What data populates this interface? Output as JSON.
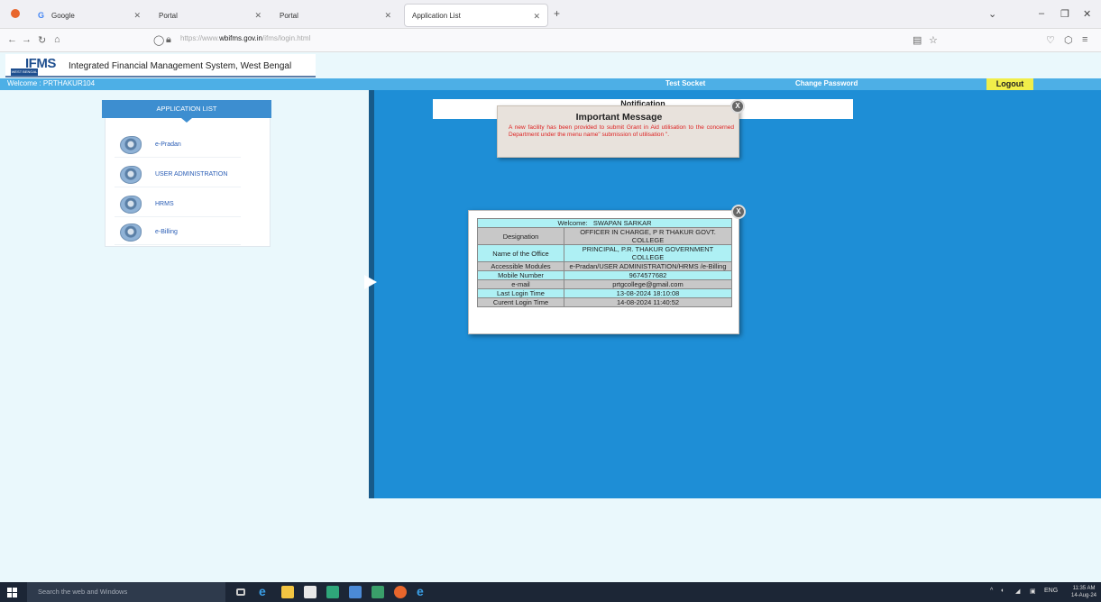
{
  "browser": {
    "tabs": [
      {
        "label": "Google",
        "active": false
      },
      {
        "label": "Portal",
        "active": false
      },
      {
        "label": "Portal",
        "active": false
      },
      {
        "label": "Application List",
        "active": true
      }
    ],
    "new_tab": "+",
    "url_prefix": "https://www.",
    "url_domain": "wbifms.gov.in",
    "url_path": "/ifms/login.html"
  },
  "header": {
    "logo_text": "IFMS",
    "logo_sub": "WEST BENGAL",
    "system_title": "Integrated Financial Management System, West Bengal"
  },
  "topbar": {
    "welcome": "Welcome : PRTHAKUR104",
    "test_socket": "Test Socket",
    "change_password": "Change Password",
    "logout": "Logout"
  },
  "app_list": {
    "title": "APPLICATION LIST",
    "items": [
      "e-Pradan",
      "USER ADMINISTRATION",
      "HRMS",
      "e-Billing"
    ]
  },
  "notification": {
    "title": "Notification"
  },
  "important_message": {
    "title": "Important Message",
    "body": "A new facility has been provided to submit Grant in Aid utilisation to the concerned Department under the menu name\" submission of utilisation \".",
    "close": "X"
  },
  "welcome_box": {
    "close": "X",
    "welcome_label": "Welcome",
    "welcome_name": "SWAPAN SARKAR",
    "rows": [
      {
        "label": "Designation",
        "value": "OFFICER IN CHARGE, P R THAKUR GOVT. COLLEGE"
      },
      {
        "label": "Name of the Office",
        "value": "PRINCIPAL, P.R. THAKUR GOVERNMENT COLLEGE"
      },
      {
        "label": "Accessible Modules",
        "value": "e-Pradan/USER ADMINISTRATION/HRMS /e-Billing"
      },
      {
        "label": "Mobile Number",
        "value": "9674577682"
      },
      {
        "label": "e-mail",
        "value": "prtgcollege@gmail.com"
      },
      {
        "label": "Last Login Time",
        "value": "13-08-2024 18:10:08"
      },
      {
        "label": "Curent Login Time",
        "value": "14-08-2024 11:40:52"
      }
    ]
  },
  "taskbar": {
    "search_placeholder": "Search the web and Windows",
    "lang": "ENG",
    "time": "11:35 AM",
    "date": "14-Aug-24"
  }
}
